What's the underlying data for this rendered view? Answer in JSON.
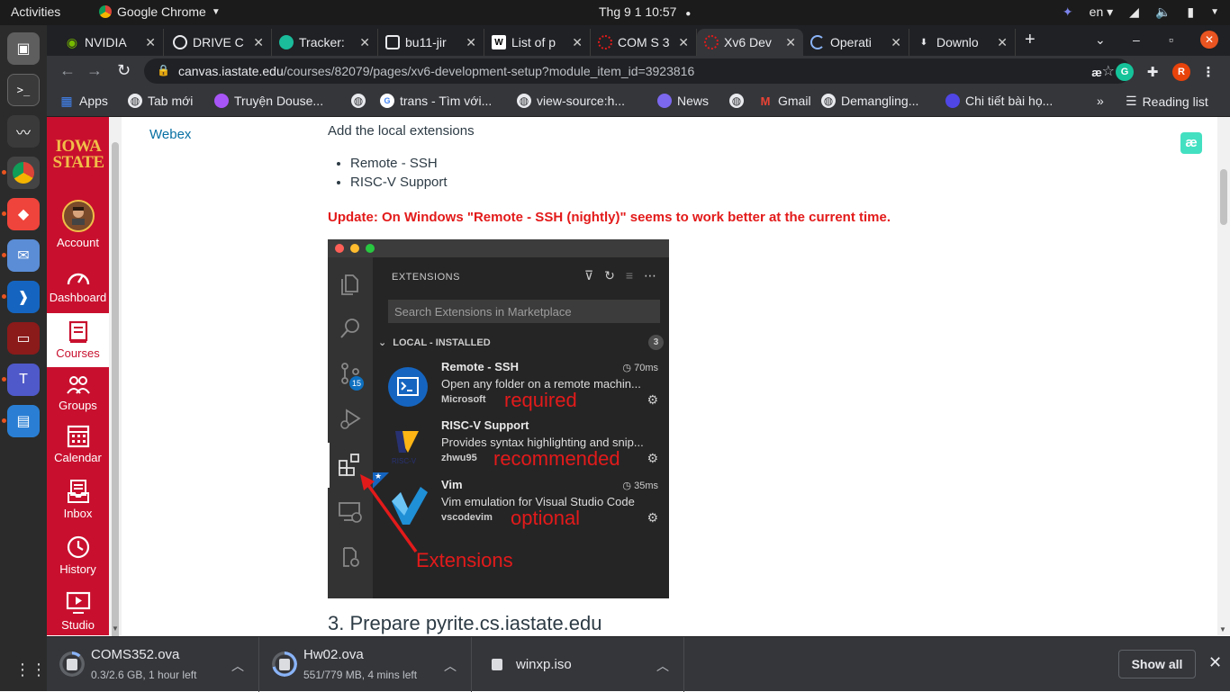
{
  "system": {
    "activities": "Activities",
    "app_name": "Google Chrome",
    "clock": "Thg 9 1  10:57",
    "lang": "en"
  },
  "tabs": [
    {
      "label": "NVIDIA",
      "icon": "nvidia-icon",
      "color": "#76b900",
      "active": false
    },
    {
      "label": "DRIVE C",
      "icon": "globe-icon",
      "color": "#e8eaed",
      "active": false
    },
    {
      "label": "Tracker:",
      "icon": "tracker-icon",
      "color": "#1abc9c",
      "active": false
    },
    {
      "label": "bu11-jir",
      "icon": "doc-icon",
      "color": "#e8eaed",
      "active": false
    },
    {
      "label": "List of p",
      "icon": "wikipedia-icon",
      "color": "#e8eaed",
      "active": false
    },
    {
      "label": "COM S 3",
      "icon": "spinner-icon",
      "color": "#e31a1a",
      "active": false
    },
    {
      "label": "Xv6 Dev",
      "icon": "spinner-icon",
      "color": "#e31a1a",
      "active": true
    },
    {
      "label": "Operati",
      "icon": "loading-icon",
      "color": "#8ab4f8",
      "active": false
    },
    {
      "label": "Downlo",
      "icon": "download-icon",
      "color": "#e8eaed",
      "active": false
    }
  ],
  "address": {
    "host": "canvas.iastate.edu",
    "path": "/courses/82079/pages/xv6-development-setup?module_item_id=3923816"
  },
  "bookmarks": [
    {
      "label": "Apps",
      "icon": "apps-grid-icon"
    },
    {
      "label": "Tab mới",
      "icon": "globe-icon"
    },
    {
      "label": "Truyện Douse...",
      "icon": "manga-icon"
    },
    {
      "label": "",
      "icon": "globe-icon"
    },
    {
      "label": "trans - Tìm với...",
      "icon": "google-icon"
    },
    {
      "label": "view-source:h...",
      "icon": "globe-icon"
    },
    {
      "label": "News",
      "icon": "news-icon"
    },
    {
      "label": "",
      "icon": "globe-icon"
    },
    {
      "label": "Gmail",
      "icon": "gmail-icon"
    },
    {
      "label": "Demangling...",
      "icon": "globe-icon"
    },
    {
      "label": "Chi tiết bài họ...",
      "icon": "shield-icon"
    }
  ],
  "reading_list": "Reading list",
  "more_chevron": "»",
  "canvas_nav": {
    "logo_line1": "IOWA",
    "logo_line2": "STATE",
    "items": [
      {
        "label": "Account",
        "icon": "avatar-icon"
      },
      {
        "label": "Dashboard",
        "icon": "dashboard-icon"
      },
      {
        "label": "Courses",
        "icon": "courses-icon"
      },
      {
        "label": "Groups",
        "icon": "groups-icon"
      },
      {
        "label": "Calendar",
        "icon": "calendar-icon"
      },
      {
        "label": "Inbox",
        "icon": "inbox-icon"
      },
      {
        "label": "History",
        "icon": "history-icon"
      },
      {
        "label": "Studio",
        "icon": "studio-icon"
      }
    ]
  },
  "course_nav": {
    "webex": "Webex"
  },
  "page": {
    "intro": "Add the local extensions",
    "bullets": [
      "Remote - SSH",
      "RISC-V Support"
    ],
    "update": "Update: On Windows \"Remote - SSH (nightly)\" seems to work better at the current time.",
    "heading": "3. Prepare pyrite.cs.iastate.edu"
  },
  "screenshot": {
    "title": "EXTENSIONS",
    "search_placeholder": "Search Extensions in Marketplace",
    "section": "LOCAL - INSTALLED",
    "section_count": "3",
    "scm_badge": "15",
    "extensions": [
      {
        "name": "Remote - SSH",
        "time": "70ms",
        "desc": "Open any folder on a remote machin...",
        "publisher": "Microsoft",
        "annotation": "required"
      },
      {
        "name": "RISC-V Support",
        "time": "",
        "desc": "Provides syntax highlighting and snip...",
        "publisher": "zhwu95",
        "annotation": "recommended"
      },
      {
        "name": "Vim",
        "time": "35ms",
        "desc": "Vim emulation for Visual Studio Code",
        "publisher": "vscodevim",
        "annotation": "optional"
      }
    ],
    "arrow_label": "Extensions"
  },
  "downloads": [
    {
      "name": "COMS352.ova",
      "status": "0.3/2.6 GB, 1 hour left",
      "progress": 0.12
    },
    {
      "name": "Hw02.ova",
      "status": "551/779 MB, 4 mins left",
      "progress": 0.71
    },
    {
      "name": "winxp.iso",
      "status": "",
      "progress": 1.0
    }
  ],
  "show_all": "Show all"
}
